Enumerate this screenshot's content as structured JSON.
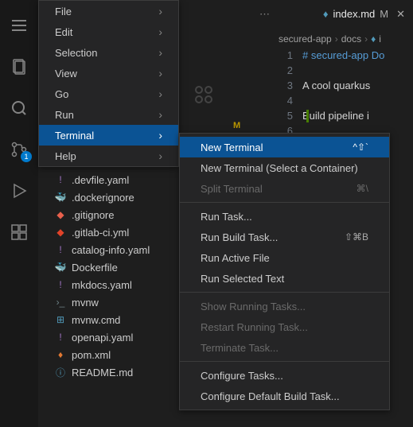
{
  "activity_badge": "1",
  "tab": {
    "name": "index.md",
    "modified": "M"
  },
  "breadcrumb": {
    "seg1": "secured-app",
    "seg2": "docs",
    "seg3": "i"
  },
  "menu": {
    "items": [
      {
        "label": "File"
      },
      {
        "label": "Edit"
      },
      {
        "label": "Selection"
      },
      {
        "label": "View"
      },
      {
        "label": "Go"
      },
      {
        "label": "Run"
      },
      {
        "label": "Terminal"
      },
      {
        "label": "Help"
      }
    ]
  },
  "submenu": {
    "new_terminal": "New Terminal",
    "new_terminal_shortcut": "^⇧`",
    "new_terminal_container": "New Terminal (Select a Container)",
    "split_terminal": "Split Terminal",
    "split_terminal_shortcut": "⌘\\",
    "run_task": "Run Task...",
    "run_build_task": "Run Build Task...",
    "run_build_task_shortcut": "⇧⌘B",
    "run_active_file": "Run Active File",
    "run_selected_text": "Run Selected Text",
    "show_running_tasks": "Show Running Tasks...",
    "restart_running_task": "Restart Running Task...",
    "terminate_task": "Terminate Task...",
    "configure_tasks": "Configure Tasks...",
    "configure_default_build": "Configure Default Build Task..."
  },
  "files": [
    {
      "name": ".devfile.yaml",
      "color": "#a074c4"
    },
    {
      "name": ".dockerignore",
      "color": "#519aba"
    },
    {
      "name": ".gitignore",
      "color": "#e8604c"
    },
    {
      "name": ".gitlab-ci.yml",
      "color": "#e24329"
    },
    {
      "name": "catalog-info.yaml",
      "color": "#a074c4"
    },
    {
      "name": "Dockerfile",
      "color": "#519aba"
    },
    {
      "name": "mkdocs.yaml",
      "color": "#a074c4"
    },
    {
      "name": "mvnw",
      "color": "#6d8086"
    },
    {
      "name": "mvnw.cmd",
      "color": "#519aba"
    },
    {
      "name": "openapi.yaml",
      "color": "#a074c4"
    },
    {
      "name": "pom.xml",
      "color": "#e37933"
    },
    {
      "name": "README.md",
      "color": "#519aba"
    }
  ],
  "editor": {
    "l1": "# secured-app Do",
    "l3": "A cool quarkus ",
    "l5": "Build pipeline i"
  }
}
